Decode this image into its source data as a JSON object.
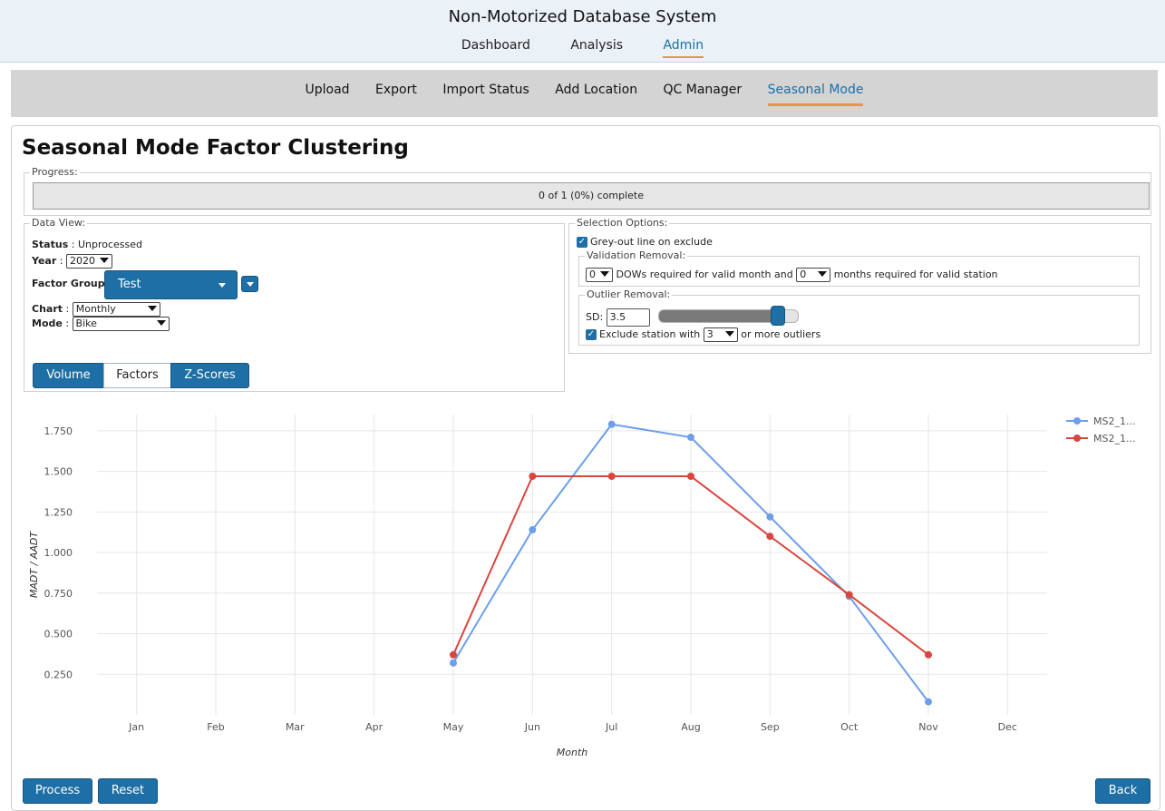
{
  "app": {
    "title": "Non-Motorized Database System"
  },
  "top_nav": [
    {
      "label": "Dashboard"
    },
    {
      "label": "Analysis"
    },
    {
      "label": "Admin"
    }
  ],
  "sub_nav": [
    {
      "label": "Upload"
    },
    {
      "label": "Export"
    },
    {
      "label": "Import Status"
    },
    {
      "label": "Add Location"
    },
    {
      "label": "QC Manager"
    },
    {
      "label": "Seasonal Mode"
    }
  ],
  "page": {
    "title": "Seasonal Mode Factor Clustering"
  },
  "progress": {
    "legend": "Progress:",
    "text": "0 of 1 (0%) complete",
    "fraction": 0
  },
  "data_view": {
    "legend": "Data View:",
    "status_label": "Status",
    "status_value": "Unprocessed",
    "year_label": "Year",
    "year_value": "2020",
    "factor_group_label": "Factor Group",
    "factor_group_value": "Test",
    "chart_label": "Chart",
    "chart_value": "Monthly",
    "mode_label": "Mode",
    "mode_value": "Bike",
    "view_buttons": [
      {
        "label": "Volume"
      },
      {
        "label": "Factors"
      },
      {
        "label": "Z-Scores"
      }
    ]
  },
  "selection_options": {
    "legend": "Selection Options:",
    "greyout_label": "Grey-out line on exclude",
    "greyout_checked": true,
    "validation": {
      "legend": "Validation Removal:",
      "dows_value": "0",
      "dows_text": "DOWs required for valid month and",
      "months_value": "0",
      "months_text": "months required for valid station"
    },
    "outlier": {
      "legend": "Outlier Removal:",
      "sd_label": "SD:",
      "sd_value": "3.5",
      "slider_fraction": 0.85,
      "exclude_prefix": "Exclude station with",
      "exclude_value": "3",
      "exclude_suffix": "or more outliers",
      "exclude_checked": true
    }
  },
  "chart_data": {
    "type": "line",
    "xlabel": "Month",
    "ylabel": "MADT / AADT",
    "categories": [
      "Jan",
      "Feb",
      "Mar",
      "Apr",
      "May",
      "Jun",
      "Jul",
      "Aug",
      "Sep",
      "Oct",
      "Nov",
      "Dec"
    ],
    "y_ticks": [
      "0.250",
      "0.500",
      "0.750",
      "1.000",
      "1.250",
      "1.500",
      "1.750"
    ],
    "ylim": [
      0.1,
      1.8
    ],
    "grid": true,
    "legend_position": "top-right",
    "series": [
      {
        "name": "MS2_1...",
        "color": "#6d9eeb",
        "values": [
          null,
          null,
          null,
          null,
          0.32,
          1.14,
          1.79,
          1.71,
          1.22,
          0.73,
          0.08,
          null
        ]
      },
      {
        "name": "MS2_1...",
        "color": "#d9463e",
        "values": [
          null,
          null,
          null,
          null,
          0.37,
          1.47,
          1.47,
          1.47,
          1.1,
          0.74,
          0.37,
          null
        ]
      }
    ]
  },
  "footer": {
    "process_label": "Process",
    "reset_label": "Reset",
    "back_label": "Back"
  }
}
